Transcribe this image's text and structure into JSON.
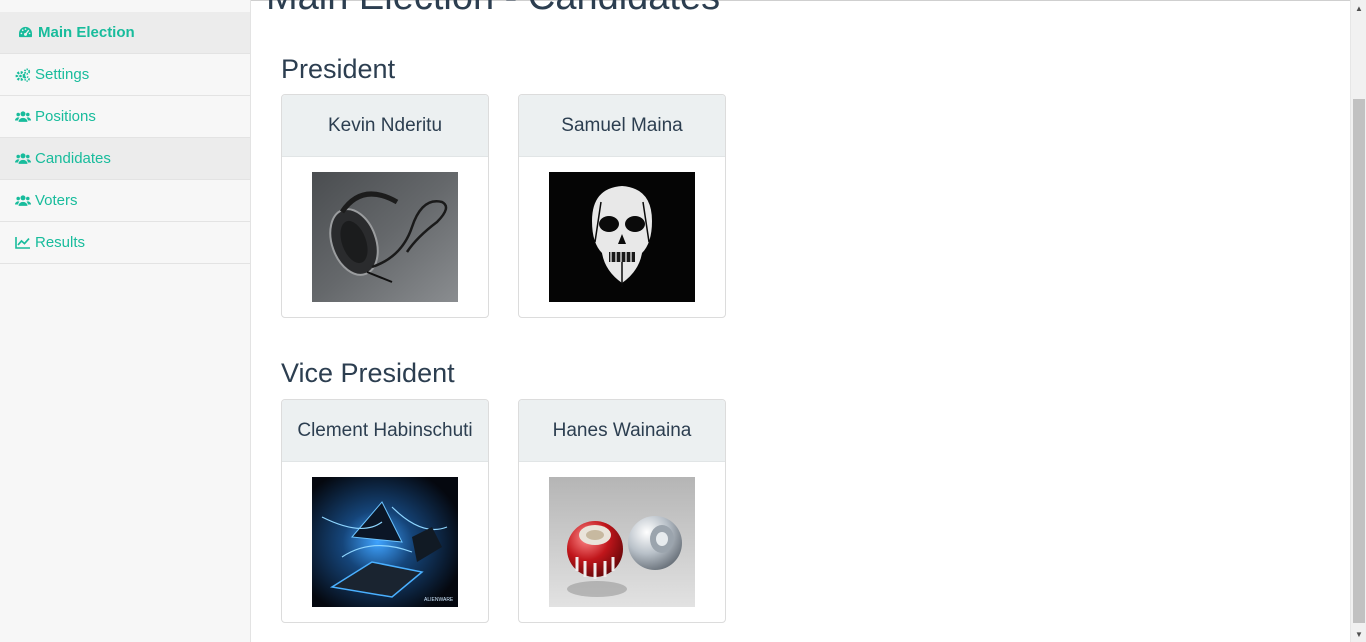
{
  "sidebar": {
    "items": [
      {
        "label": "Main Election",
        "icon": "dashboard-icon"
      },
      {
        "label": "Settings",
        "icon": "cogs-icon"
      },
      {
        "label": "Positions",
        "icon": "users-icon"
      },
      {
        "label": "Candidates",
        "icon": "users-icon"
      },
      {
        "label": "Voters",
        "icon": "users-icon"
      },
      {
        "label": "Results",
        "icon": "line-chart-icon"
      }
    ]
  },
  "page": {
    "title": "Main Election - Candidates"
  },
  "positions": [
    {
      "title": "President",
      "candidates": [
        {
          "name": "Kevin Nderitu",
          "photo": "headphones-photo"
        },
        {
          "name": "Samuel Maina",
          "photo": "skull-mask-photo"
        }
      ]
    },
    {
      "title": "Vice President",
      "candidates": [
        {
          "name": "Clement Habinschuti",
          "photo": "alienware-photo",
          "photo_caption": "ALIENWARE"
        },
        {
          "name": "Hanes Wainaina",
          "photo": "spheres-photo"
        }
      ]
    }
  ],
  "colors": {
    "accent": "#18bc9c",
    "text": "#2c3e50",
    "card_header": "#ecf0f1"
  }
}
